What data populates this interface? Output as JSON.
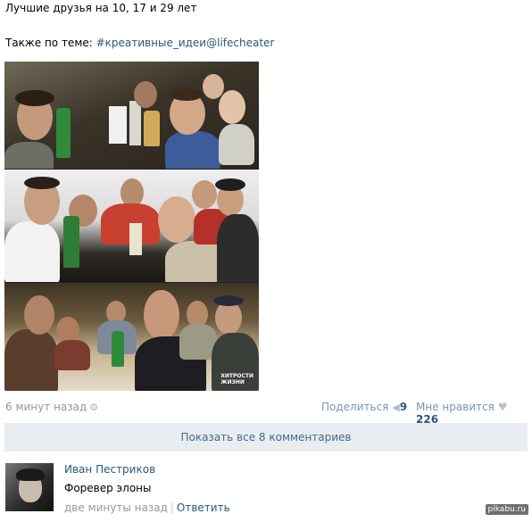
{
  "post": {
    "title": "Лучшие друзья на 10, 17 и 29 лет",
    "related_prefix": "Также по теме: ",
    "related_tag": "#креативные_идеи@lifecheater",
    "photo_logo_line1": "ХИТРОСТИ",
    "photo_logo_line2": "ЖИЗНИ",
    "time": "6 минут назад",
    "share_label": "Поделиться",
    "share_count": "9",
    "like_label": "Мне нравится",
    "like_count": "226",
    "icons": {
      "settings": "gear-icon",
      "share": "megaphone-icon",
      "like": "heart-icon"
    }
  },
  "comments_bar": {
    "label": "Показать все 8 комментариев"
  },
  "comment": {
    "author": "Иван Пестриков",
    "text": "Форевер элоны",
    "time": "две минуты назад",
    "reply_label": "Ответить"
  },
  "watermark": "pikabu.ru"
}
